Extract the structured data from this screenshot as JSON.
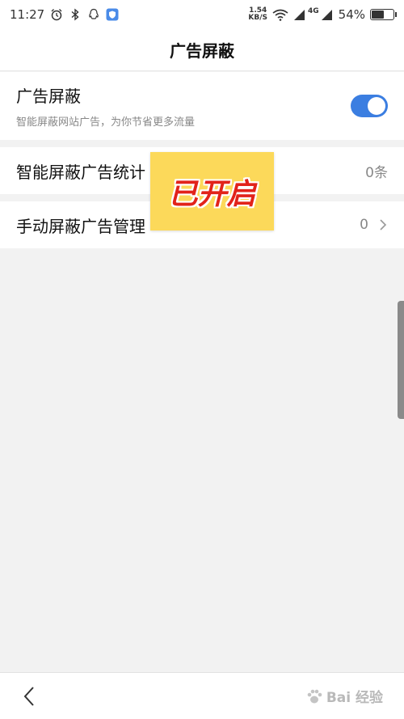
{
  "status_bar": {
    "time": "11:27",
    "net_speed_value": "1.54",
    "net_speed_unit": "KB/S",
    "signal_label": "4G",
    "battery_percent": "54%",
    "battery_level": 0.54
  },
  "header": {
    "title": "广告屏蔽"
  },
  "ad_block_toggle": {
    "label": "广告屏蔽",
    "description": "智能屏蔽网站广告，为你节省更多流量",
    "enabled": true
  },
  "smart_block_stats": {
    "label": "智能屏蔽广告统计",
    "value": "0条"
  },
  "manual_block_manage": {
    "label": "手动屏蔽广告管理",
    "value": "0"
  },
  "overlay_label": "已开启",
  "watermark": "Bai 经验",
  "colors": {
    "accent": "#3b7ee1",
    "overlay_bg": "#fcd95a",
    "overlay_text": "#e2231a"
  }
}
